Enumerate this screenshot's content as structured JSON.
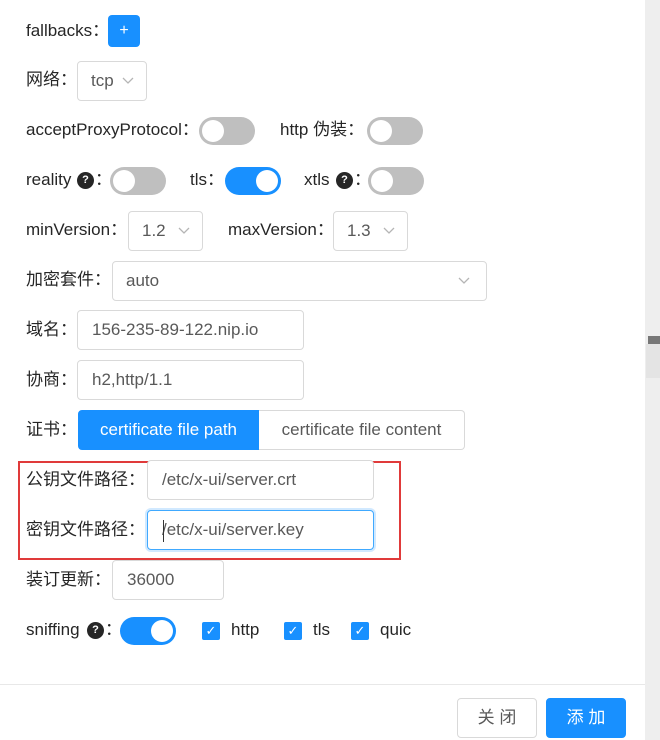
{
  "form": {
    "fallbacks_label": "fallbacks：",
    "fallbacks_add": "+",
    "network_label": "网络：",
    "network_value": "tcp",
    "accept_proxy_label": "acceptProxyProtocol：",
    "accept_proxy_on": false,
    "http_disguise_label": "http 伪装：",
    "http_disguise_on": false,
    "reality_label": "reality",
    "reality_on": false,
    "tls_label": "tls：",
    "tls_on": true,
    "xtls_label": "xtls",
    "xtls_on": false,
    "colon": "：",
    "help_glyph": "?",
    "min_version_label": "minVersion：",
    "min_version_value": "1.2",
    "max_version_label": "maxVersion：",
    "max_version_value": "1.3",
    "cipher_label": "加密套件：",
    "cipher_value": "auto",
    "domain_label": "域名：",
    "domain_value": "156-235-89-122.nip.io",
    "alpn_label": "协商：",
    "alpn_value": "h2,http/1.1",
    "cert_label": "证书：",
    "cert_tabs": [
      "certificate file path",
      "certificate file content"
    ],
    "cert_tab_selected": "certificate file path",
    "public_key_label": "公钥文件路径：",
    "public_key_value": "/etc/x-ui/server.crt",
    "private_key_label": "密钥文件路径：",
    "private_key_value": "/etc/x-ui/server.key",
    "renew_label": "装订更新：",
    "renew_value": "36000",
    "sniffing_label": "sniffing",
    "sniffing_on": true,
    "sniff_options": [
      {
        "label": "http",
        "checked": true
      },
      {
        "label": "tls",
        "checked": true
      },
      {
        "label": "quic",
        "checked": true
      }
    ]
  },
  "footer": {
    "close_label": "关 闭",
    "add_label": "添 加"
  },
  "colors": {
    "primary": "#1890ff",
    "highlight": "#e03a3a",
    "toggle_off": "#bfbfbf"
  },
  "icons": {
    "chevron": "chevron-down-icon",
    "help": "question-circle-icon",
    "check": "check-icon"
  }
}
